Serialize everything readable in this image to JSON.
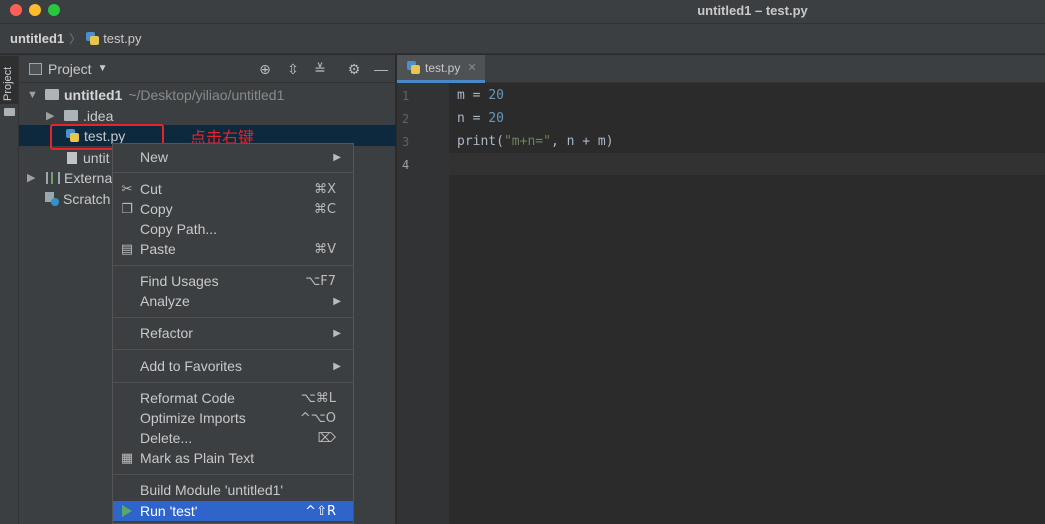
{
  "window": {
    "title": "untitled1 – test.py"
  },
  "navbar": {
    "project": "untitled1",
    "separator": "〉",
    "file": "test.py"
  },
  "stripe": {
    "label": "Project"
  },
  "panel": {
    "title": "Project",
    "tree": {
      "root": {
        "name": "untitled1",
        "path": "~/Desktop/yiliao/untitled1"
      },
      "idea": ".idea",
      "file": "test.py",
      "hidden_item": "untit",
      "external": "Externa",
      "scratches": "Scratch"
    }
  },
  "annotation": "点击右键",
  "editor": {
    "tab": "test.py",
    "lines": [
      "1",
      "2",
      "3",
      "4"
    ],
    "code": {
      "line1": {
        "var": "m = ",
        "num": "20"
      },
      "line2": {
        "var": "n = ",
        "num": "20"
      },
      "line3": {
        "fn": "print(",
        "str": "\"m+n=\"",
        "rest": ", n + m)"
      }
    }
  },
  "context_menu": {
    "items": [
      {
        "label": "New",
        "shortcut": "",
        "submenu": true
      },
      {
        "label": "Cut",
        "shortcut": "⌘X",
        "icon": "scissors-icon"
      },
      {
        "label": "Copy",
        "shortcut": "⌘C",
        "icon": "copy-icon"
      },
      {
        "label": "Copy Path...",
        "shortcut": ""
      },
      {
        "label": "Paste",
        "shortcut": "⌘V",
        "icon": "paste-icon"
      },
      {
        "label": "Find Usages",
        "shortcut": "⌥F7"
      },
      {
        "label": "Analyze",
        "shortcut": "",
        "submenu": true
      },
      {
        "label": "Refactor",
        "shortcut": "",
        "submenu": true
      },
      {
        "label": "Add to Favorites",
        "shortcut": "",
        "submenu": true
      },
      {
        "label": "Reformat Code",
        "shortcut": "⌥⌘L"
      },
      {
        "label": "Optimize Imports",
        "shortcut": "^⌥O"
      },
      {
        "label": "Delete...",
        "shortcut": "⌦"
      },
      {
        "label": "Mark as Plain Text",
        "shortcut": "",
        "icon": "plain-text-icon"
      },
      {
        "label": "Build Module 'untitled1'",
        "shortcut": ""
      },
      {
        "label": "Run 'test'",
        "shortcut": "^⇧R",
        "icon": "run-icon"
      }
    ]
  }
}
